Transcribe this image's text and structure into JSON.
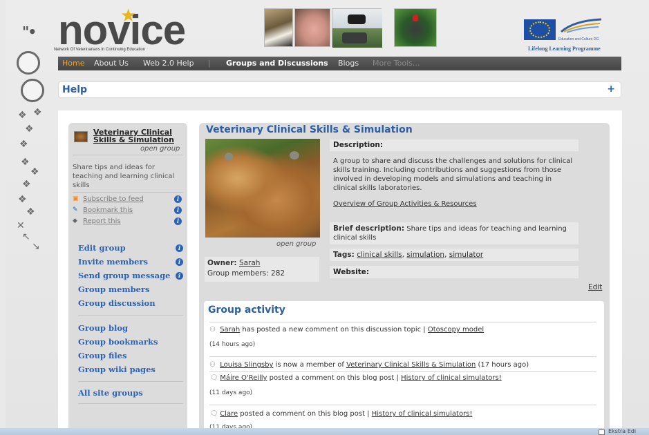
{
  "logo": {
    "word": "novice",
    "tagline": "Network Of Veterinarians In Continuing Education"
  },
  "eu": {
    "small_text": "Education and Culture DG",
    "programme": "Lifelong Learning Programme"
  },
  "nav": {
    "home": "Home",
    "about": "About Us",
    "web20": "Web 2.0 Help",
    "separator": "|",
    "groups": "Groups and Discussions",
    "blogs": "Blogs",
    "more": "More Tools..."
  },
  "help": {
    "title": "Help",
    "plus": "+"
  },
  "sidebar": {
    "group_name": "Veterinary Clinical Skills & Simulation",
    "group_type": "open group",
    "description": "Share tips and ideas for teaching and learning clinical skills",
    "links": [
      {
        "label": "Subscribe to feed",
        "icon": "rss-icon"
      },
      {
        "label": "Bookmark this",
        "icon": "bookmark-icon"
      },
      {
        "label": "Report this",
        "icon": "report-icon"
      }
    ],
    "actions": [
      {
        "label": "Edit group",
        "info": true
      },
      {
        "label": "Invite members",
        "info": true
      },
      {
        "label": "Send group message",
        "info": true
      },
      {
        "label": "Group members",
        "info": false
      },
      {
        "label": "Group discussion",
        "info": false
      }
    ],
    "actions2": [
      {
        "label": "Group blog"
      },
      {
        "label": "Group bookmarks"
      },
      {
        "label": "Group files"
      },
      {
        "label": "Group wiki pages"
      }
    ],
    "all_groups": "All site groups"
  },
  "group": {
    "title": "Veterinary Clinical Skills & Simulation",
    "photo_caption": "open group",
    "owner_label": "Owner:",
    "owner_name": "Sarah",
    "members_label": "Group members: 282",
    "description_label": "Description:",
    "description": "A group to share and discuss the challenges and solutions for clinical skills training. Including contributions and suggestions from those involved in developing models and simulations and teaching in clinical skills laboratories.",
    "description_link": "Overview of Group Activities & Resources",
    "brief_label": "Brief description:",
    "brief": "Share tips and ideas for teaching and learning clinical skills",
    "tags_label": "Tags:",
    "tags": [
      "clinical skills",
      "simulation",
      "simulator"
    ],
    "website_label": "Website:",
    "edit": "Edit"
  },
  "activity": {
    "title": "Group activity",
    "items": [
      {
        "user": "Sarah",
        "text": " has posted a new comment on this discussion topic | ",
        "link": "Otoscopy model",
        "time": "(14 hours ago)",
        "icon": "members-icon"
      },
      {
        "user": "Louisa Slingsby",
        "text": " is now a member of ",
        "link": "Veterinary Clinical Skills & Simulation",
        "suffix": " (17 hours ago)",
        "icon": "members-icon"
      },
      {
        "user": "Máire O'Reilly",
        "text": " posted a comment on this blog post | ",
        "link": "History of clinical simulators!",
        "time": "(11 days ago)",
        "icon": "comment-icon"
      },
      {
        "user": "Clare",
        "text": " posted a comment on this blog post | ",
        "link": "History of clinical simulators!",
        "time": "(11 days ago)",
        "icon": "comment-icon"
      }
    ]
  },
  "statusbar": {
    "text": "Ekstra Edi"
  }
}
